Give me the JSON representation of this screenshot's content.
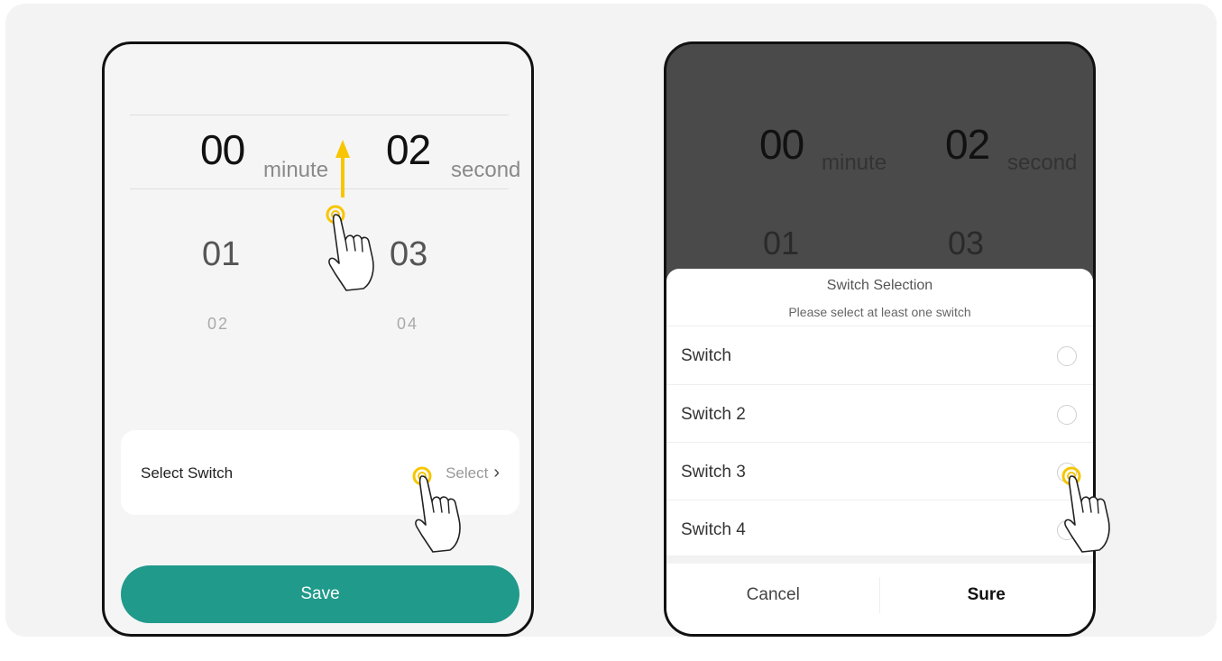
{
  "left_phone": {
    "picker": {
      "minute_selected": "00",
      "minute_unit": "minute",
      "second_selected": "02",
      "second_unit": "second",
      "minute_next": "01",
      "second_next": "03",
      "minute_next2": "02",
      "second_next2": "04"
    },
    "select_switch_label": "Select Switch",
    "select_value": "Select",
    "save_label": "Save"
  },
  "right_phone": {
    "picker": {
      "minute_selected": "00",
      "minute_unit": "minute",
      "second_selected": "02",
      "second_unit": "second",
      "minute_next": "01",
      "second_next": "03"
    },
    "sheet": {
      "title": "Switch Selection",
      "subtitle": "Please select at least one switch",
      "options": [
        {
          "label": "Switch",
          "checked": false
        },
        {
          "label": "Switch 2",
          "checked": false
        },
        {
          "label": "Switch 3",
          "checked": false
        },
        {
          "label": "Switch 4",
          "checked": false
        }
      ],
      "cancel_label": "Cancel",
      "sure_label": "Sure"
    }
  },
  "colors": {
    "accent": "#209a8b",
    "gesture": "#f7c600",
    "overlay": "#4a4a4a"
  }
}
